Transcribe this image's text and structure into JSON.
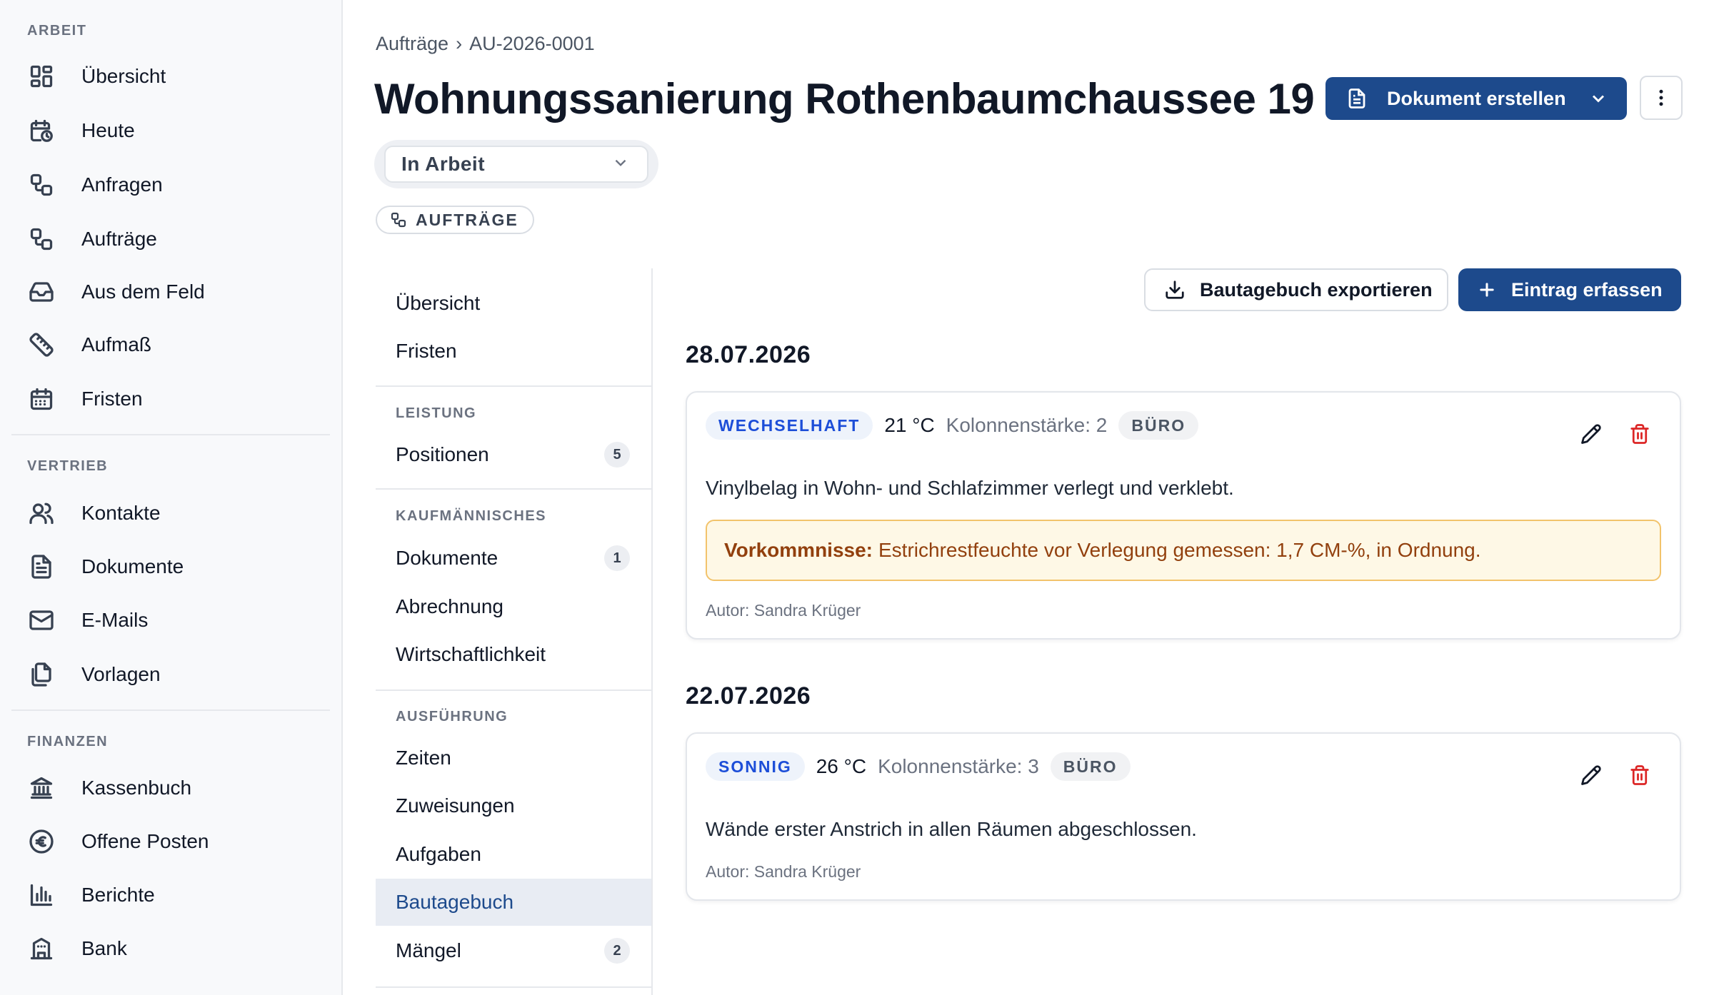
{
  "sidebar": {
    "sections": [
      {
        "title": "ARBEIT",
        "items": [
          {
            "label": "Übersicht",
            "icon": "dashboard-icon"
          },
          {
            "label": "Heute",
            "icon": "calendar-clock-icon"
          },
          {
            "label": "Anfragen",
            "icon": "workflow-icon"
          },
          {
            "label": "Aufträge",
            "icon": "workflow-icon"
          },
          {
            "label": "Aus dem Feld",
            "icon": "inbox-icon"
          },
          {
            "label": "Aufmaß",
            "icon": "ruler-icon"
          },
          {
            "label": "Fristen",
            "icon": "calendar-icon"
          }
        ]
      },
      {
        "title": "VERTRIEB",
        "items": [
          {
            "label": "Kontakte",
            "icon": "users-icon"
          },
          {
            "label": "Dokumente",
            "icon": "document-icon"
          },
          {
            "label": "E-Mails",
            "icon": "mail-icon"
          },
          {
            "label": "Vorlagen",
            "icon": "files-icon"
          }
        ]
      },
      {
        "title": "FINANZEN",
        "items": [
          {
            "label": "Kassenbuch",
            "icon": "bank-icon"
          },
          {
            "label": "Offene Posten",
            "icon": "euro-icon"
          },
          {
            "label": "Berichte",
            "icon": "bar-chart-icon"
          },
          {
            "label": "Bank",
            "icon": "building-icon"
          }
        ]
      }
    ]
  },
  "header": {
    "breadcrumb": [
      "Aufträge",
      "›",
      "AU-2026-0001"
    ],
    "title": "Wohnungssanierung Rothenbaumchaussee 19",
    "primary_action": "Dokument erstellen",
    "status": "In Arbeit",
    "tag": "AUFTRÄGE"
  },
  "subnav": {
    "top": [
      "Übersicht",
      "Fristen"
    ],
    "groups": [
      {
        "title": "LEISTUNG",
        "items": [
          {
            "label": "Positionen",
            "badge": "5"
          }
        ]
      },
      {
        "title": "KAUFMÄNNISCHES",
        "items": [
          {
            "label": "Dokumente",
            "badge": "1"
          },
          {
            "label": "Abrechnung"
          },
          {
            "label": "Wirtschaftlichkeit"
          }
        ]
      },
      {
        "title": "AUSFÜHRUNG",
        "items": [
          {
            "label": "Zeiten"
          },
          {
            "label": "Zuweisungen"
          },
          {
            "label": "Aufgaben"
          },
          {
            "label": "Bautagebuch",
            "active": true
          },
          {
            "label": "Mängel",
            "badge": "2"
          }
        ]
      }
    ]
  },
  "content": {
    "export_button": "Bautagebuch exportieren",
    "add_button": "Eintrag erfassen",
    "entries": [
      {
        "date": "28.07.2026",
        "weather": "WECHSELHAFT",
        "temperature": "21 °C",
        "crew": "Kolonnenstärke: 2",
        "origin": "BÜRO",
        "description": "Vinylbelag in Wohn- und Schlafzimmer verlegt und verklebt.",
        "incident_label": "Vorkommnisse:",
        "incident_text": "Estrichrestfeuchte vor Verlegung gemessen: 1,7 CM-%, in Ordnung.",
        "author": "Autor: Sandra Krüger"
      },
      {
        "date": "22.07.2026",
        "weather": "SONNIG",
        "temperature": "26 °C",
        "crew": "Kolonnenstärke: 3",
        "origin": "BÜRO",
        "description": "Wände erster Anstrich in allen Räumen abgeschlossen.",
        "author": "Autor: Sandra Krüger"
      }
    ]
  },
  "colors": {
    "accent": "#1d4a8c",
    "weather_text": "#1d4ed8",
    "delete": "#dc2626",
    "incident_bg": "#fef8e6",
    "incident_border": "#f2c36b"
  }
}
